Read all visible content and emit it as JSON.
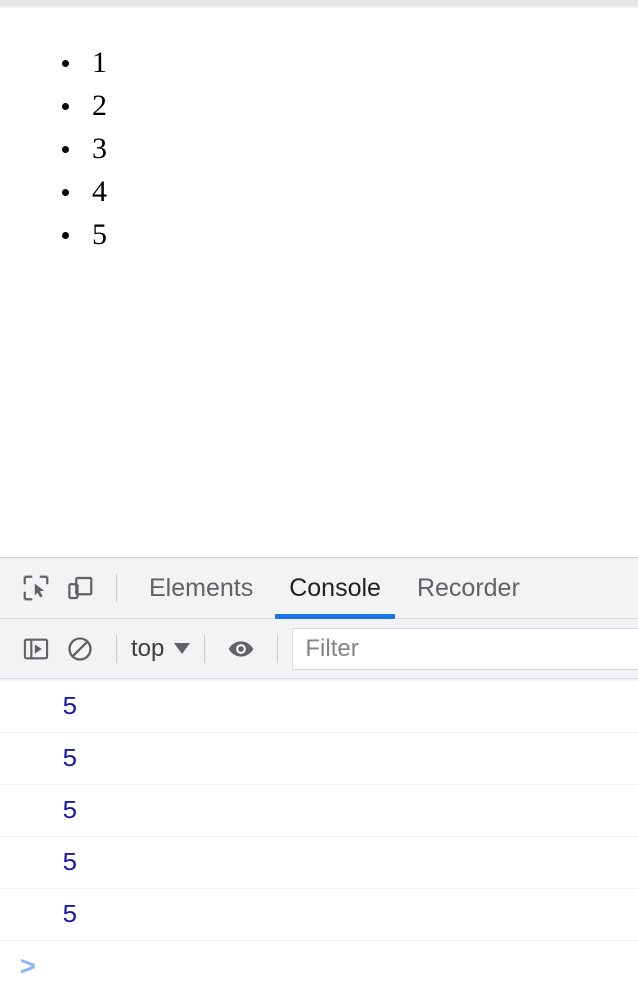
{
  "page": {
    "list_items": [
      "1",
      "2",
      "3",
      "4",
      "5"
    ]
  },
  "devtools": {
    "icons": {
      "inspect": "inspect-element-icon",
      "device": "device-toolbar-icon",
      "sidebar": "console-sidebar-toggle-icon",
      "clear": "clear-console-icon",
      "eye": "live-expression-eye-icon"
    },
    "tabs": [
      {
        "label": "Elements",
        "active": false
      },
      {
        "label": "Console",
        "active": true
      },
      {
        "label": "Recorder",
        "active": false
      }
    ],
    "toolbar": {
      "context_label": "top",
      "filter_placeholder": "Filter",
      "filter_value": ""
    },
    "console_messages": [
      "5",
      "5",
      "5",
      "5",
      "5"
    ],
    "prompt_symbol": ">",
    "colors": {
      "accent": "#1a73e8",
      "number_value": "#1a1aa6",
      "prompt": "#8ab4f8",
      "toolbar_bg": "#f1f3f4",
      "tab_inactive_text": "#5f6368"
    }
  }
}
